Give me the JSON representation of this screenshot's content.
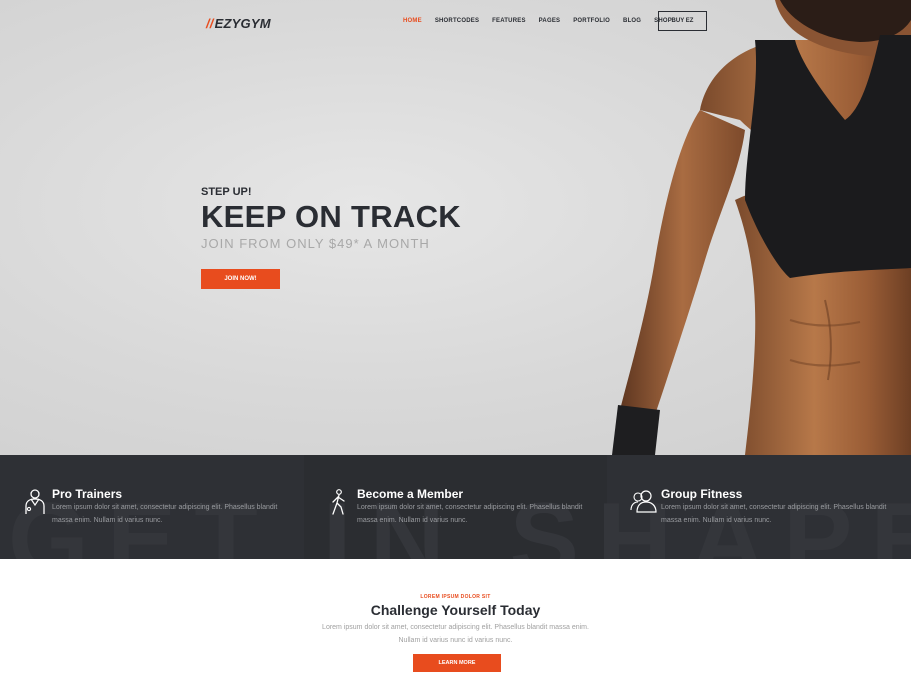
{
  "brand": {
    "slashes": "//",
    "name": "EZYGYM"
  },
  "nav": {
    "items": [
      "HOME",
      "SHORTCODES",
      "FEATURES",
      "PAGES",
      "PORTFOLIO",
      "BLOG",
      "SHOP"
    ],
    "active": "HOME",
    "cta": "BUY EZ"
  },
  "hero": {
    "kicker": "STEP UP!",
    "title": "KEEP ON TRACK",
    "subtitle": "JOIN FROM ONLY $49* A MONTH",
    "button": "JOIN NOW!"
  },
  "features": {
    "background_word": "GET IN SHAPE",
    "items": [
      {
        "icon": "trainer-icon",
        "title": "Pro Trainers",
        "desc": "Lorem ipsum dolor sit amet, consectetur adipiscing elit. Phasellus blandit massa enim. Nullam id varius nunc."
      },
      {
        "icon": "walking-person-icon",
        "title": "Become a Member",
        "desc": "Lorem ipsum dolor sit amet, consectetur adipiscing elit. Phasellus blandit massa enim. Nullam id varius nunc."
      },
      {
        "icon": "group-icon",
        "title": "Group Fitness",
        "desc": "Lorem ipsum dolor sit amet, consectetur adipiscing elit. Phasellus blandit massa enim. Nullam id varius nunc."
      }
    ]
  },
  "challenge": {
    "eyebrow": "LOREM IPSUM DOLOR SIT",
    "title": "Challenge Yourself Today",
    "desc": "Lorem ipsum dolor sit amet, consectetur adipiscing elit. Phasellus blandit massa enim. Nullam id varius nunc id varius nunc.",
    "button": "LEARN MORE"
  },
  "colors": {
    "accent": "#e84c1e",
    "dark": "#2e3035",
    "text": "#2a2d33"
  }
}
